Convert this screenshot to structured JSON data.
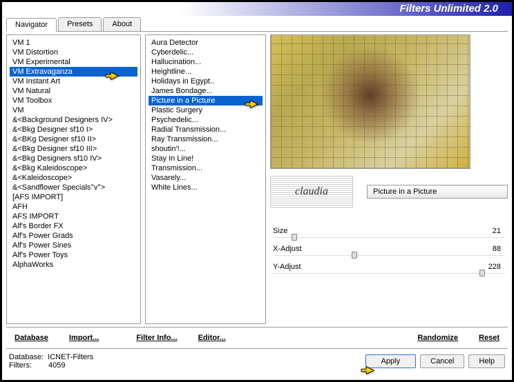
{
  "title": "Filters Unlimited 2.0",
  "tabs": [
    "Navigator",
    "Presets",
    "About"
  ],
  "activeTab": "Navigator",
  "categories": [
    "VM 1",
    "VM Distortion",
    "VM Experimental",
    "VM Extravaganza",
    "VM Instant Art",
    "VM Natural",
    "VM Toolbox",
    "VM",
    "&<Background Designers IV>",
    "&<Bkg Designer sf10 I>",
    "&<BKg Designer sf10 II>",
    "&<Bkg Designer sf10 III>",
    "&<Bkg Designers sf10 IV>",
    "&<Bkg Kaleidoscope>",
    "&<Kaleidoscope>",
    "&<Sandflower Specials°v°>",
    "[AFS IMPORT]",
    "AFH",
    "AFS IMPORT",
    "Alf's Border FX",
    "Alf's Power Grads",
    "Alf's Power Sines",
    "Alf's Power Toys",
    "AlphaWorks"
  ],
  "selectedCategory": "VM Extravaganza",
  "filters": [
    "Aura Detector",
    "Cyberdelic...",
    "Hallucination...",
    "Heightline...",
    "Holidays in Egypt..",
    "James Bondage...",
    "Picture in a Picture",
    "Plastic Surgery",
    "Psychedelic...",
    "Radial Transmission...",
    "Ray Transmission...",
    "shoutin'!...",
    "Stay In Line!",
    "Transmission...",
    "Vasarely...",
    "White Lines..."
  ],
  "selectedFilter": "Picture in a Picture",
  "currentFilterName": "Picture in a Picture",
  "params": [
    {
      "label": "Size",
      "value": "21",
      "pos": 8
    },
    {
      "label": "X-Adjust",
      "value": "88",
      "pos": 34
    },
    {
      "label": "Y-Adjust",
      "value": "228",
      "pos": 89
    }
  ],
  "logo_text": "claudia",
  "toolbar": {
    "database": "Database",
    "import": "Import...",
    "filterinfo": "Filter Info...",
    "editor": "Editor...",
    "randomize": "Randomize",
    "reset": "Reset"
  },
  "footer": {
    "db_label": "Database:",
    "db_value": "ICNET-Filters",
    "filters_label": "Filters:",
    "filters_value": "4059",
    "apply": "Apply",
    "cancel": "Cancel",
    "help": "Help"
  }
}
